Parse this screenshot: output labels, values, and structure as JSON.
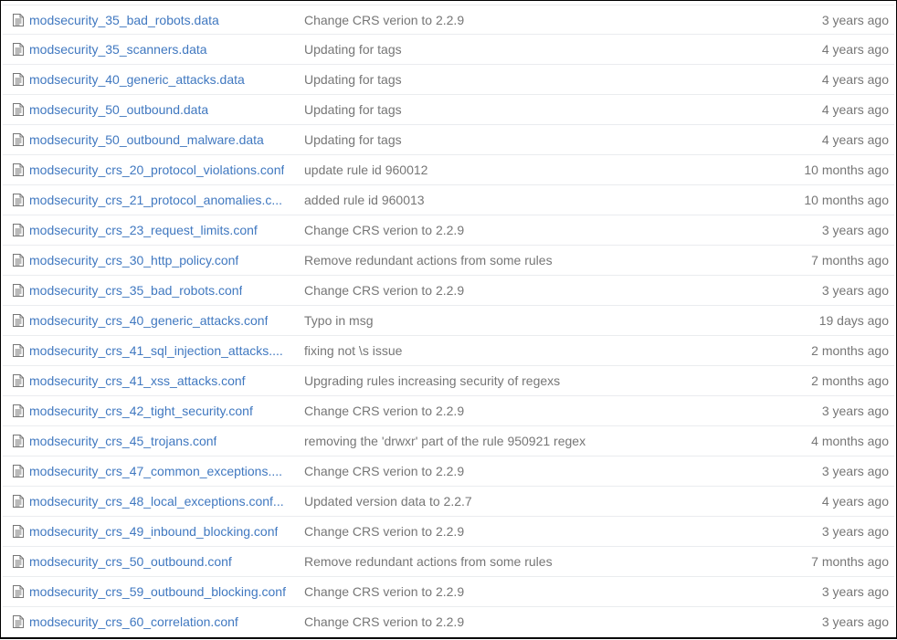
{
  "files": [
    {
      "icon": "file-text-icon",
      "name": "modsecurity_35_bad_robots.data",
      "message": "Change CRS verion to 2.2.9",
      "age": "3 years ago"
    },
    {
      "icon": "file-text-icon",
      "name": "modsecurity_35_scanners.data",
      "message": "Updating for tags",
      "age": "4 years ago"
    },
    {
      "icon": "file-text-icon",
      "name": "modsecurity_40_generic_attacks.data",
      "message": "Updating for tags",
      "age": "4 years ago"
    },
    {
      "icon": "file-text-icon",
      "name": "modsecurity_50_outbound.data",
      "message": "Updating for tags",
      "age": "4 years ago"
    },
    {
      "icon": "file-text-icon",
      "name": "modsecurity_50_outbound_malware.data",
      "message": "Updating for tags",
      "age": "4 years ago"
    },
    {
      "icon": "file-text-icon",
      "name": "modsecurity_crs_20_protocol_violations.conf",
      "message": "update rule id 960012",
      "age": "10 months ago"
    },
    {
      "icon": "file-text-icon",
      "name": "modsecurity_crs_21_protocol_anomalies.c...",
      "message": "added rule id 960013",
      "age": "10 months ago"
    },
    {
      "icon": "file-text-icon",
      "name": "modsecurity_crs_23_request_limits.conf",
      "message": "Change CRS verion to 2.2.9",
      "age": "3 years ago"
    },
    {
      "icon": "file-text-icon",
      "name": "modsecurity_crs_30_http_policy.conf",
      "message": "Remove redundant actions from some rules",
      "age": "7 months ago"
    },
    {
      "icon": "file-text-icon",
      "name": "modsecurity_crs_35_bad_robots.conf",
      "message": "Change CRS verion to 2.2.9",
      "age": "3 years ago"
    },
    {
      "icon": "file-text-icon",
      "name": "modsecurity_crs_40_generic_attacks.conf",
      "message": "Typo in msg",
      "age": "19 days ago"
    },
    {
      "icon": "file-text-icon",
      "name": "modsecurity_crs_41_sql_injection_attacks....",
      "message": "fixing not \\s issue",
      "age": "2 months ago"
    },
    {
      "icon": "file-text-icon",
      "name": "modsecurity_crs_41_xss_attacks.conf",
      "message": "Upgrading rules increasing security of regexs",
      "age": "2 months ago"
    },
    {
      "icon": "file-text-icon",
      "name": "modsecurity_crs_42_tight_security.conf",
      "message": "Change CRS verion to 2.2.9",
      "age": "3 years ago"
    },
    {
      "icon": "file-text-icon",
      "name": "modsecurity_crs_45_trojans.conf",
      "message": "removing the 'drwxr' part of the rule 950921 regex",
      "age": "4 months ago"
    },
    {
      "icon": "file-text-icon",
      "name": "modsecurity_crs_47_common_exceptions....",
      "message": "Change CRS verion to 2.2.9",
      "age": "3 years ago"
    },
    {
      "icon": "file-text-icon",
      "name": "modsecurity_crs_48_local_exceptions.conf...",
      "message": "Updated version data to 2.2.7",
      "age": "4 years ago"
    },
    {
      "icon": "file-text-icon",
      "name": "modsecurity_crs_49_inbound_blocking.conf",
      "message": "Change CRS verion to 2.2.9",
      "age": "3 years ago"
    },
    {
      "icon": "file-text-icon",
      "name": "modsecurity_crs_50_outbound.conf",
      "message": "Remove redundant actions from some rules",
      "age": "7 months ago"
    },
    {
      "icon": "file-text-icon",
      "name": "modsecurity_crs_59_outbound_blocking.conf",
      "message": "Change CRS verion to 2.2.9",
      "age": "3 years ago"
    },
    {
      "icon": "file-text-icon",
      "name": "modsecurity_crs_60_correlation.conf",
      "message": "Change CRS verion to 2.2.9",
      "age": "3 years ago"
    }
  ],
  "colors": {
    "link": "#4078c0",
    "muted": "#767676",
    "row_border": "#eaecef",
    "icon": "#767676"
  }
}
